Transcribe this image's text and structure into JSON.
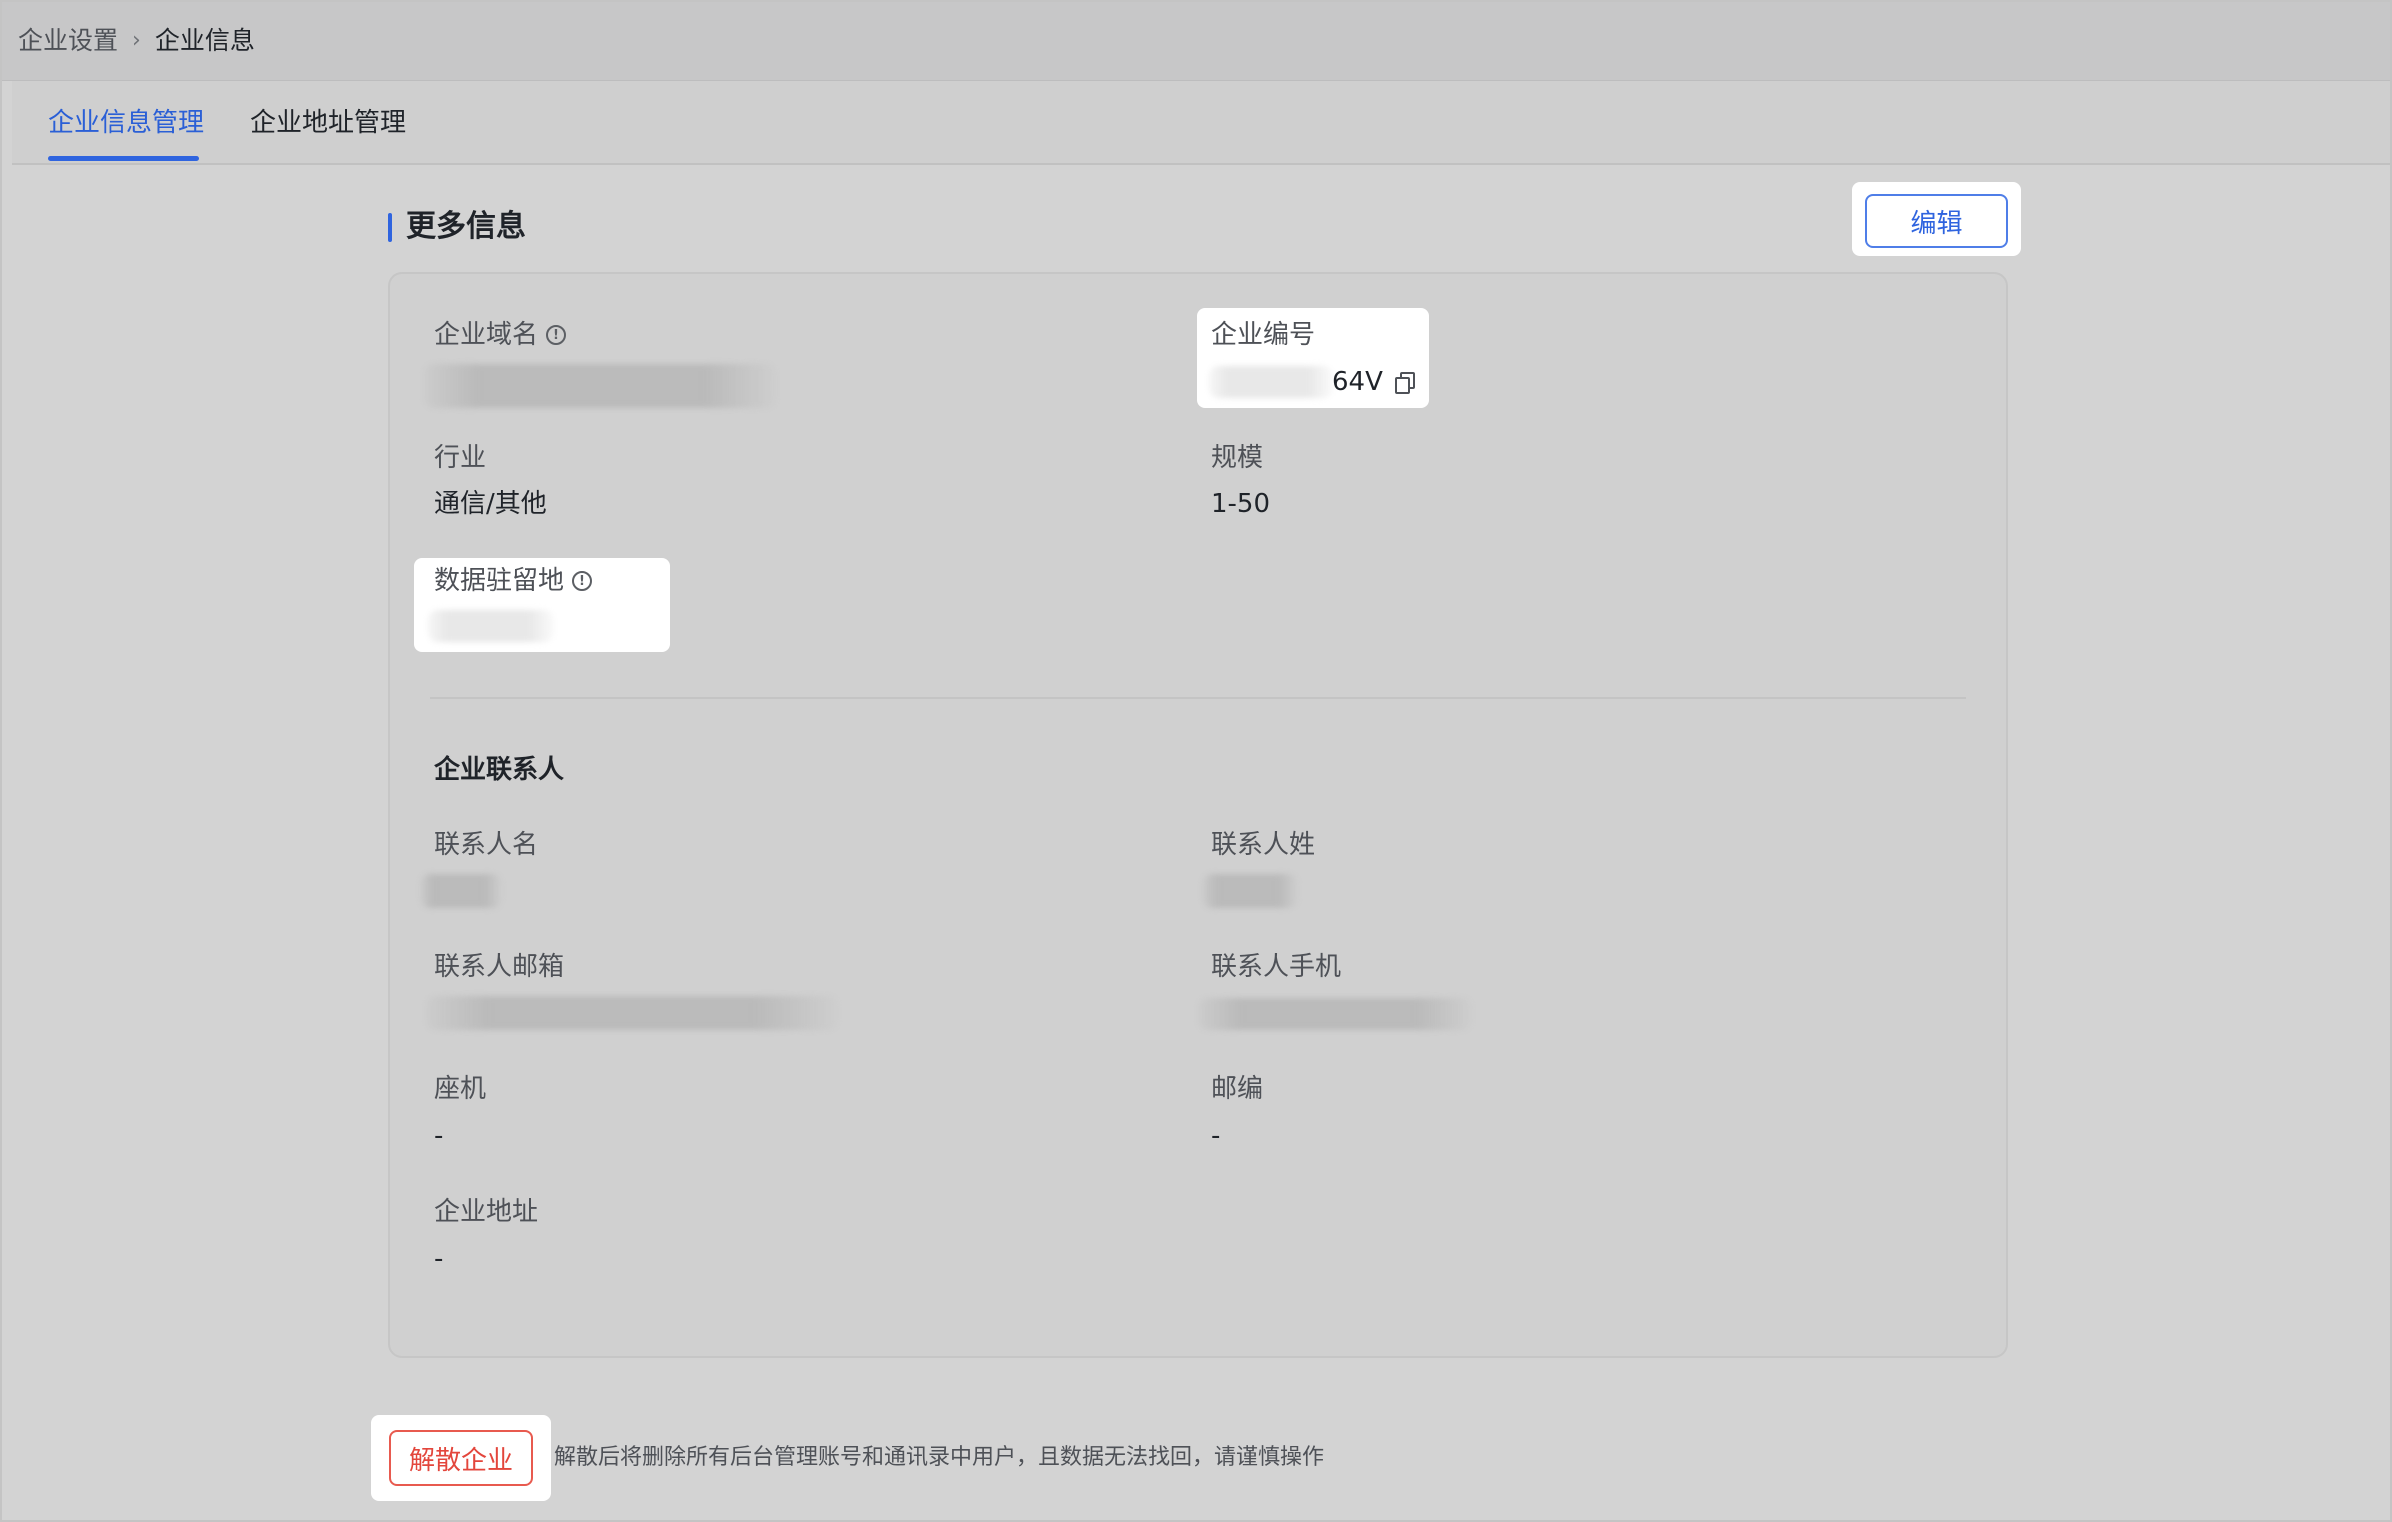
{
  "breadcrumb": {
    "parent": "企业设置",
    "separator": "›",
    "current": "企业信息"
  },
  "tabs": [
    {
      "label": "企业信息管理",
      "active": true
    },
    {
      "label": "企业地址管理",
      "active": false
    }
  ],
  "section": {
    "title": "更多信息",
    "edit_label": "编辑"
  },
  "fields": {
    "domain_label": "企业域名",
    "code_label": "企业编号",
    "code_value_visible": "64V",
    "industry_label": "行业",
    "industry_value": "通信/其他",
    "scale_label": "规模",
    "scale_value": "1-50",
    "residency_label": "数据驻留地"
  },
  "contact": {
    "heading": "企业联系人",
    "first_name_label": "联系人名",
    "last_name_label": "联系人姓",
    "email_label": "联系人邮箱",
    "mobile_label": "联系人手机",
    "landline_label": "座机",
    "landline_value": "-",
    "postcode_label": "邮编",
    "postcode_value": "-",
    "address_label": "企业地址",
    "address_value": "-"
  },
  "danger": {
    "dissolve_label": "解散企业",
    "note": "解散后将删除所有后台管理账号和通讯录中用户，且数据无法找回，请谨慎操作"
  },
  "icons": {
    "info": "info-circle-icon",
    "copy": "copy-icon",
    "chevron": "chevron-right-icon"
  },
  "colors": {
    "accent": "#2f64df",
    "danger": "#e3463c"
  }
}
